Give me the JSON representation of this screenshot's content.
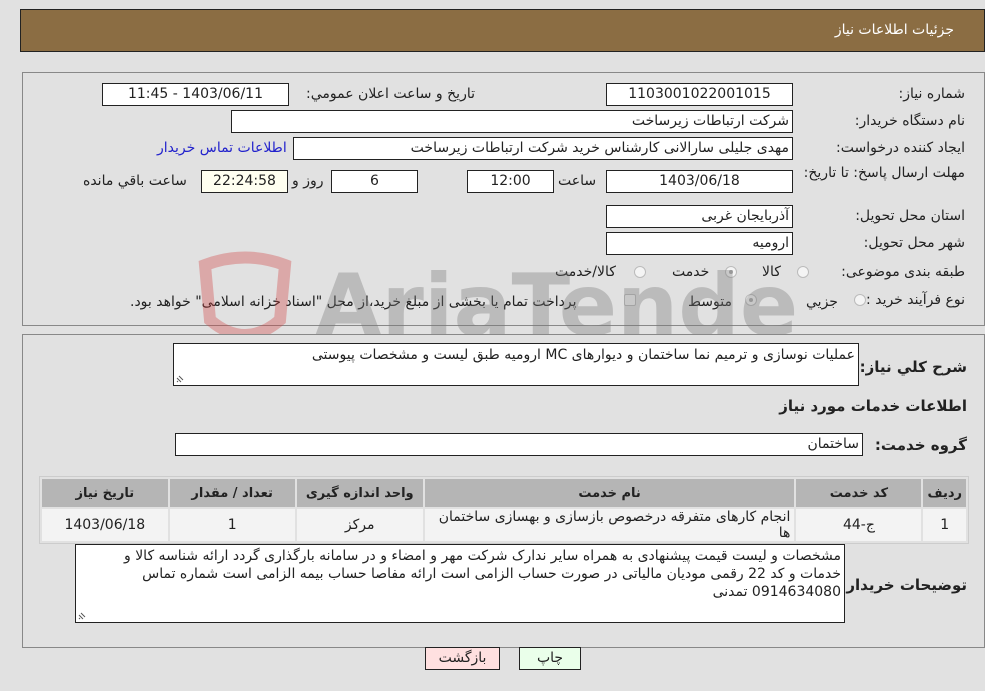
{
  "header": {
    "title": "جزئیات اطلاعات نیاز"
  },
  "form": {
    "need_number_label": "شماره نیاز:",
    "need_number": "1103001022001015",
    "announce_label": "تاریخ و ساعت اعلان عمومي:",
    "announce_value": "1403/06/11 - 11:45",
    "buyer_org_label": "نام دستگاه خریدار:",
    "buyer_org": "شرکت ارتباطات زیرساخت",
    "creator_label": "ایجاد کننده درخواست:",
    "creator": "مهدی جلیلی سارالانی کارشناس خرید شرکت ارتباطات زیرساخت",
    "contact_link": "اطلاعات تماس خریدار",
    "deadline_label": "مهلت ارسال پاسخ: تا تاریخ:",
    "deadline_date": "1403/06/18",
    "time_label": "ساعت",
    "deadline_time": "12:00",
    "days": "6",
    "days_label": "روز و",
    "remaining": "22:24:58",
    "remaining_label": "ساعت باقي مانده",
    "province_label": "استان محل تحویل:",
    "province": "آذربایجان غربی",
    "city_label": "شهر محل تحویل:",
    "city": "ارومیه",
    "category_label": "طبقه بندی موضوعی:",
    "category_options": [
      "کالا",
      "خدمت",
      "کالا/خدمت"
    ],
    "category_selected": "خدمت",
    "process_label": "نوع فرآیند خرید :",
    "process_options": [
      "جزيي",
      "متوسط"
    ],
    "process_selected": "متوسط",
    "treasury_note": "پرداخت تمام یا بخشی از مبلغ خرید،از محل \"اسناد خزانه اسلامی\" خواهد بود."
  },
  "details": {
    "description_label": "شرح کلي نیاز:",
    "description": "عملیات نوسازی و ترمیم نما ساختمان و دیوارهای MC ارومیه طبق لیست و مشخصات پیوستی",
    "services_heading": "اطلاعات خدمات مورد نیاز",
    "service_group_label": "گروه خدمت:",
    "service_group": "ساختمان",
    "table": {
      "headers": [
        "ردیف",
        "کد خدمت",
        "نام خدمت",
        "واحد اندازه گیری",
        "تعداد / مقدار",
        "تاریخ نیاز"
      ],
      "rows": [
        [
          "1",
          "ج-44",
          "انجام کارهای متفرقه درخصوص بازسازی و بهسازی ساختمان ها",
          "مرکز",
          "1",
          "1403/06/18"
        ]
      ]
    },
    "buyer_notes_label": "توضیحات خریدار:",
    "buyer_notes": "مشخصات و لیست قیمت پیشنهادی به همراه سایر ندارک شرکت مهر و امضاء و در سامانه بارگذاری گردد ارائه شناسه کالا و خدمات و کد 22 رقمی مودیان مالیاتی در صورت حساب الزامی است ارائه مفاصا حساب بیمه الزامی است شماره تماس 0914634080 تمدنی"
  },
  "buttons": {
    "print": "چاپ",
    "back": "بازگشت"
  },
  "watermark": "AriaTender.neT"
}
